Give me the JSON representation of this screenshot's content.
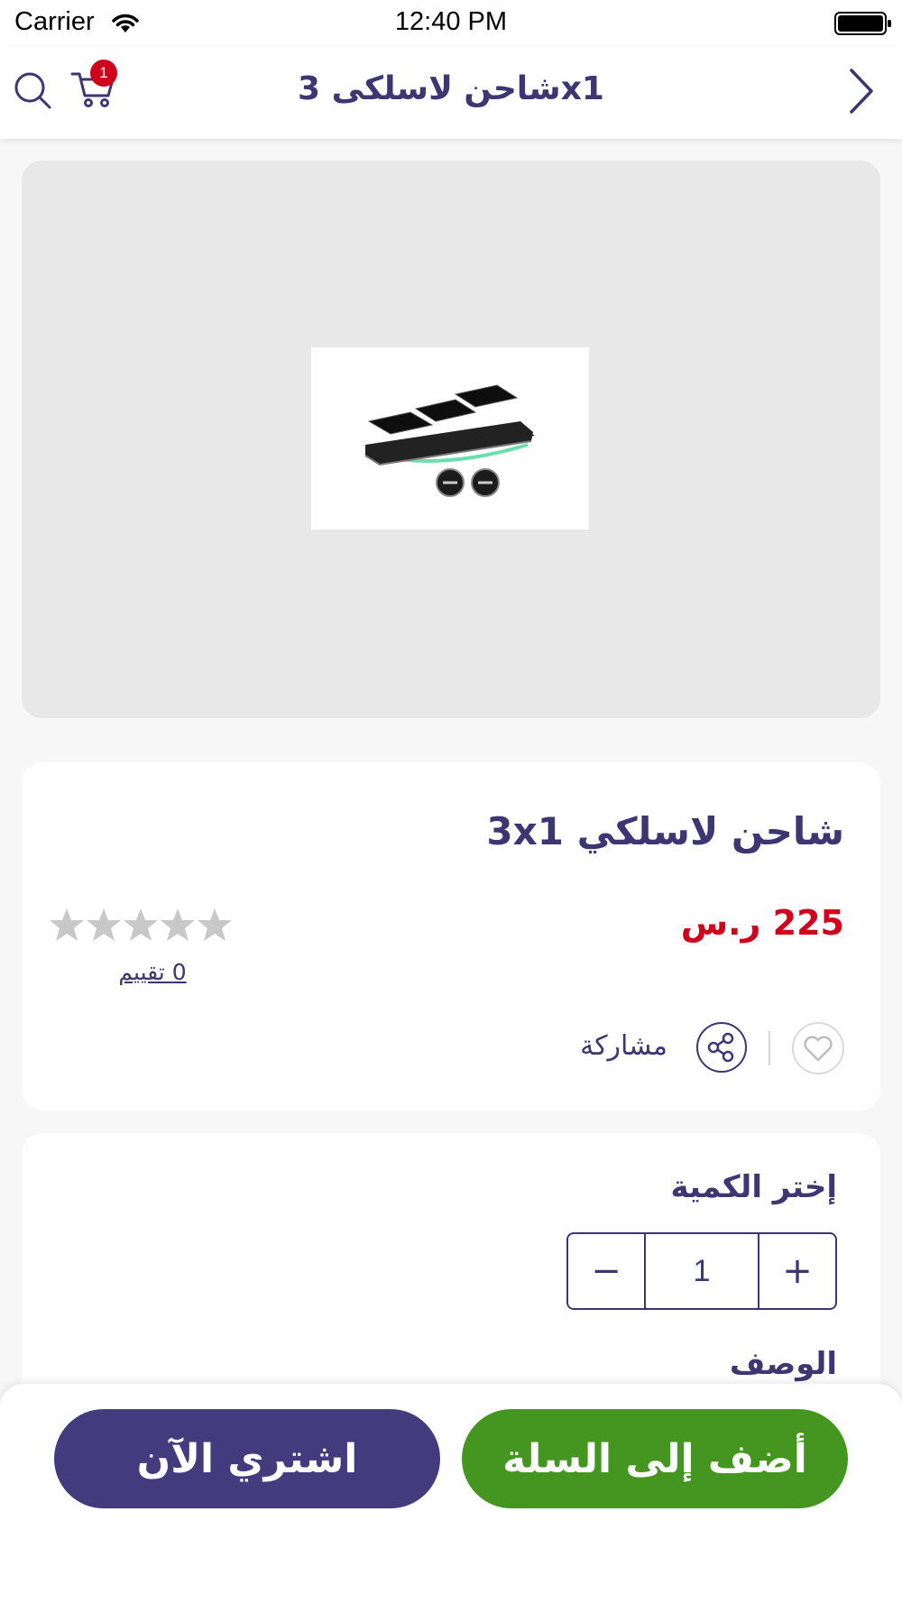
{
  "status_bar": {
    "carrier": "Carrier",
    "time": "12:40 PM"
  },
  "nav": {
    "title": "شاحن لاسلكى 3x1",
    "cart_count": "1",
    "icons": [
      "search-icon",
      "cart-icon",
      "chevron-right-icon"
    ]
  },
  "product": {
    "name": "شاحن لاسلكي 3x1",
    "price": "225 ر.س",
    "rating_text": "0  تقييم",
    "stars_filled": 0,
    "stars_total": 5,
    "share_label": "مشاركة"
  },
  "quantity": {
    "label": "إختر الكمية",
    "value": "1",
    "minus": "−",
    "plus": "+"
  },
  "description": {
    "label": "الوصف"
  },
  "actions": {
    "buy_now": "اشتري الآن",
    "add_to_cart": "أضف إلى السلة"
  },
  "colors": {
    "primary": "#3d3672",
    "price": "#d0021b",
    "buy_button": "#443a7e",
    "cart_button": "#459521"
  }
}
